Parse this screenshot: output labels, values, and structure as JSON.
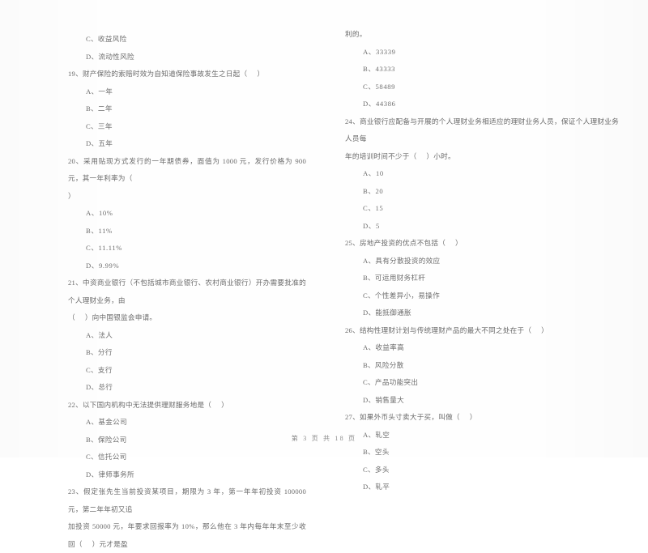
{
  "document": {
    "page_footer": "第 3 页  共 18 页",
    "page_number": "3",
    "total_pages": "18"
  },
  "left_column": {
    "carryover_options": [
      "C、收益风险",
      "D、流动性风险"
    ],
    "questions": [
      {
        "number": "19",
        "stem": "19、财产保险的索赔时效为自知道保险事故发生之日起（     ）",
        "stem_line2": "",
        "options": [
          "A、一年",
          "B、二年",
          "C、三年",
          "D、五年"
        ]
      },
      {
        "number": "20",
        "stem": "20、采用贴现方式发行的一年期债券，面值为 1000 元，发行价格为 900 元，其一年利率为（",
        "stem_line2": "）",
        "options": [
          "A、10%",
          "B、11%",
          "C、11.11%",
          "D、9.99%"
        ]
      },
      {
        "number": "21",
        "stem": "21、中资商业银行（不包括城市商业银行、农村商业银行）开办需要批准的个人理财业务，由",
        "stem_line2": "（     ）向中国银监会申请。",
        "options": [
          "A、法人",
          "B、分行",
          "C、支行",
          "D、总行"
        ]
      },
      {
        "number": "22",
        "stem": "22、以下国内机构中无法提供理财服务地是（     ）",
        "stem_line2": "",
        "options": [
          "A、基金公司",
          "B、保险公司",
          "C、信托公司",
          "D、律师事务所"
        ]
      },
      {
        "number": "23",
        "stem": "23、假定张先生当前投资某项目，期限为 3 年，第一年年初投资 100000 元，第二年年初又追",
        "stem_line2": "加投资 50000 元，年要求回报率为 10%，那么他在 3 年内每年年末至少收回（     ）元才是盈",
        "options": []
      }
    ]
  },
  "right_column": {
    "carryover_stem": "利的。",
    "carryover_options": [
      "A、33339",
      "B、43333",
      "C、58489",
      "D、44386"
    ],
    "questions": [
      {
        "number": "24",
        "stem": "24、商业银行应配备与开展的个人理财业务相适应的理财业务人员，保证个人理财业务人员每",
        "stem_line2": "年的培训时间不少于（     ）小时。",
        "options": [
          "A、10",
          "B、20",
          "C、15",
          "D、5"
        ]
      },
      {
        "number": "25",
        "stem": "25、房地产投资的优点不包括（     ）",
        "stem_line2": "",
        "options": [
          "A、具有分散投资的效应",
          "B、可运用财务杠杆",
          "C、个性差异小，易操作",
          "D、能抵御通胀"
        ]
      },
      {
        "number": "26",
        "stem": "26、结构性理财计划与传统理财产品的最大不同之处在于（     ）",
        "stem_line2": "",
        "options": [
          "A、收益率高",
          "B、风险分散",
          "C、产品功能突出",
          "D、销售量大"
        ]
      },
      {
        "number": "27",
        "stem": "27、如果外币头寸卖大于买，叫做（     ）",
        "stem_line2": "",
        "options": [
          "A、轧空",
          "B、空头",
          "C、多头",
          "D、轧平"
        ]
      }
    ]
  }
}
